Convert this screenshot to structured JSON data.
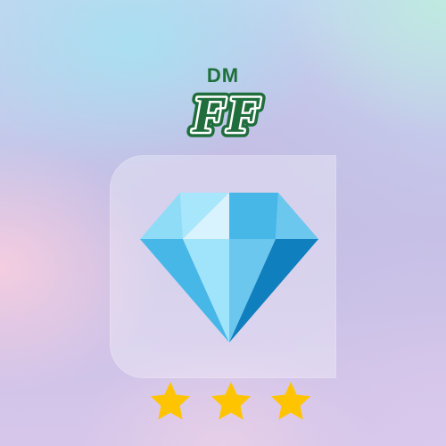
{
  "brand": {
    "top_text": "DM",
    "logo_text": "FF",
    "text_color": "#1f6e3c",
    "logo_fill": "#ffffff"
  },
  "card": {
    "icon": "diamond-icon"
  },
  "rating": {
    "value": 3,
    "max": 3,
    "star_color": "#ffc400",
    "icon": "star-icon"
  }
}
